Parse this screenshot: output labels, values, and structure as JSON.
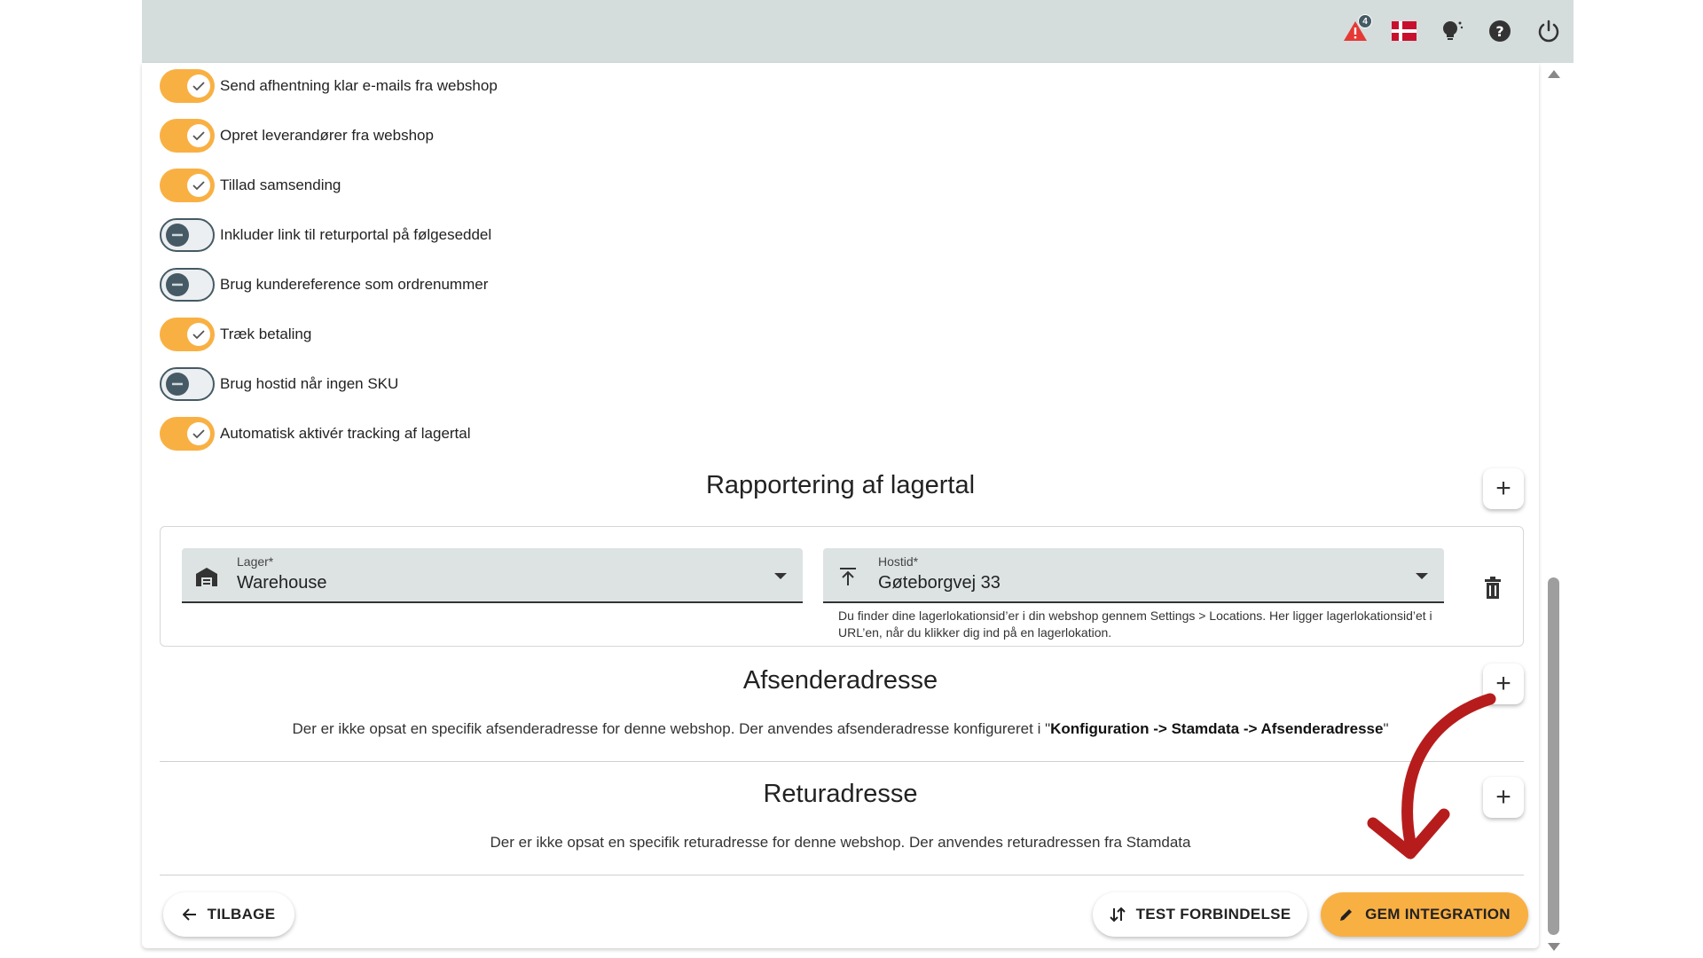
{
  "topbar": {
    "alert_count": "4",
    "icons": [
      "warning-icon",
      "danish-flag-icon",
      "theme-bulb-icon",
      "help-icon",
      "power-icon"
    ]
  },
  "toggles": [
    {
      "label": "Send afhentning klar e-mails fra webshop",
      "on": true
    },
    {
      "label": "Opret leverandører fra webshop",
      "on": true
    },
    {
      "label": "Tillad samsending",
      "on": true
    },
    {
      "label": "Inkluder link til returportal på følgeseddel",
      "on": false
    },
    {
      "label": "Brug kundereference som ordrenummer",
      "on": false
    },
    {
      "label": "Træk betaling",
      "on": true
    },
    {
      "label": "Brug hostid når ingen SKU",
      "on": false
    },
    {
      "label": "Automatisk aktivér tracking af lagertal",
      "on": true
    }
  ],
  "stock_reporting": {
    "title": "Rapportering af lagertal",
    "warehouse_label": "Lager*",
    "warehouse_value": "Warehouse",
    "hostid_label": "Hostid*",
    "hostid_value": "Gøteborgvej 33",
    "helper_text": "Du finder dine lagerlokationsid’er i din webshop gennem Settings > Locations. Her ligger lagerlokationsid’et i URL’en, når du klikker dig ind på en lagerlokation."
  },
  "sender_address": {
    "title": "Afsenderadresse",
    "text_prefix": "Der er ikke opsat en specifik afsenderadresse for denne webshop. Der anvendes afsenderadresse konfigureret i \"",
    "text_bold": "Konfiguration -> Stamdata -> Afsenderadresse",
    "text_suffix": "\""
  },
  "return_address": {
    "title": "Returadresse",
    "text": "Der er ikke opsat en specifik returadresse for denne webshop. Der anvendes returadressen fra Stamdata"
  },
  "actions": {
    "back_label": "TILBAGE",
    "test_label": "TEST FORBINDELSE",
    "save_label": "GEM INTEGRATION"
  },
  "colors": {
    "accent": "#f9b043",
    "topbar": "#d5dcdc",
    "annotation_arrow": "#b71c1c"
  }
}
